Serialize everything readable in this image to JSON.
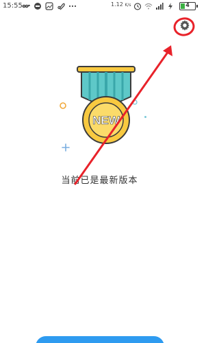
{
  "status_bar": {
    "time": "15:55",
    "network_speed": "1.12",
    "network_speed_unit": "K/s",
    "battery_level": "4",
    "battery_color": "#3cb043",
    "icons_left": [
      "link-icon",
      "chat-icon",
      "photo-icon",
      "attachment-icon",
      "more-dots-icon"
    ],
    "icons_right": [
      "alarm-icon",
      "wifi-icon",
      "signal-icon",
      "charging-icon",
      "battery-icon"
    ]
  },
  "toolbar": {
    "settings_icon": "gear-icon"
  },
  "medal": {
    "badge_text": "NEW",
    "ribbon_color": "#5ec8c8",
    "medal_color": "#f8c940"
  },
  "content": {
    "status_message": "当前已是最新版本"
  },
  "annotation": {
    "color": "#e8222a"
  },
  "footer": {
    "button_color": "#2e9bf0"
  }
}
